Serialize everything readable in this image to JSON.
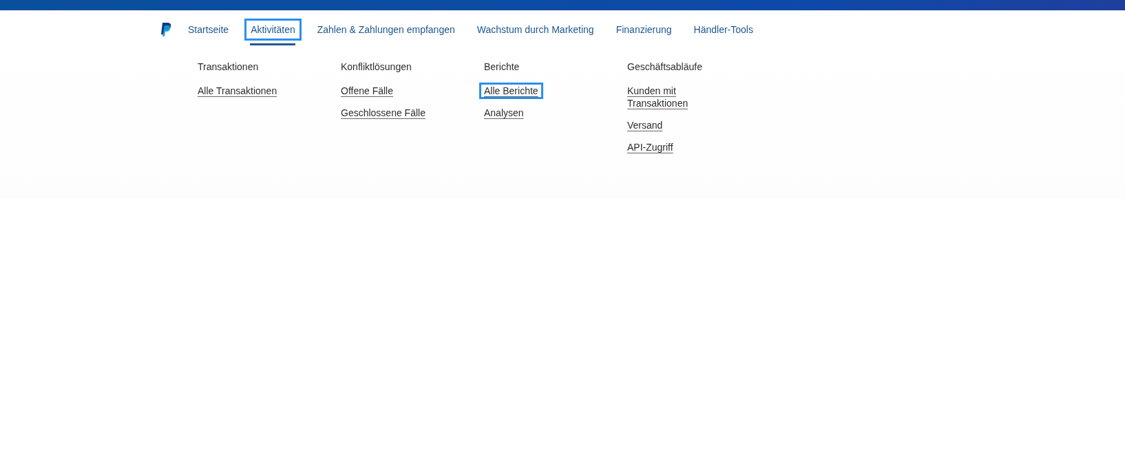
{
  "nav": {
    "items": [
      {
        "label": "Startseite",
        "selected": false,
        "highlighted": false
      },
      {
        "label": "Aktivitäten",
        "selected": true,
        "highlighted": true
      },
      {
        "label": "Zahlen & Zahlungen empfangen",
        "selected": false,
        "highlighted": false
      },
      {
        "label": "Wachstum durch Marketing",
        "selected": false,
        "highlighted": false
      },
      {
        "label": "Finanzierung",
        "selected": false,
        "highlighted": false
      },
      {
        "label": "Händler-Tools",
        "selected": false,
        "highlighted": false
      }
    ]
  },
  "menu": {
    "columns": [
      {
        "heading": "Transaktionen",
        "links": [
          {
            "label": "Alle Transaktionen",
            "highlighted": false
          }
        ]
      },
      {
        "heading": "Konfliktlösungen",
        "links": [
          {
            "label": "Offene Fälle",
            "highlighted": false
          },
          {
            "label": "Geschlossene Fälle",
            "highlighted": false
          }
        ]
      },
      {
        "heading": "Berichte",
        "links": [
          {
            "label": "Alle Berichte",
            "highlighted": true
          },
          {
            "label": "Analysen",
            "highlighted": false
          }
        ]
      },
      {
        "heading": "Geschäftsabläufe",
        "links": [
          {
            "label": "Kunden mit Transaktionen",
            "highlighted": false
          },
          {
            "label": "Versand",
            "highlighted": false
          },
          {
            "label": "API-Zugriff",
            "highlighted": false
          }
        ]
      }
    ]
  }
}
